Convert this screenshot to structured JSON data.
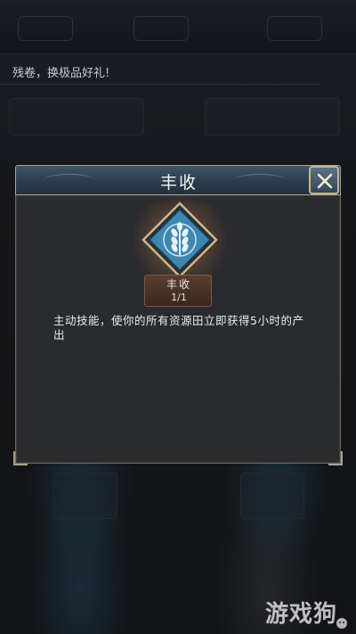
{
  "background": {
    "banner_text": "残卷，换极品好礼!"
  },
  "dialog": {
    "title": "丰收",
    "skill": {
      "name": "丰收",
      "count": "1/1",
      "icon": "wheat-icon"
    },
    "description": "主动技能，使你的所有资源田立即获得5小时的产出",
    "close_icon": "close-x-icon"
  },
  "watermark": {
    "text": "游戏狗"
  },
  "colors": {
    "title_bar": "#33475a",
    "panel": "#2a2b2e",
    "gold_border": "#c4b98f",
    "skill_plate": "#4a3326",
    "emblem_blue": "#3f86b0"
  }
}
